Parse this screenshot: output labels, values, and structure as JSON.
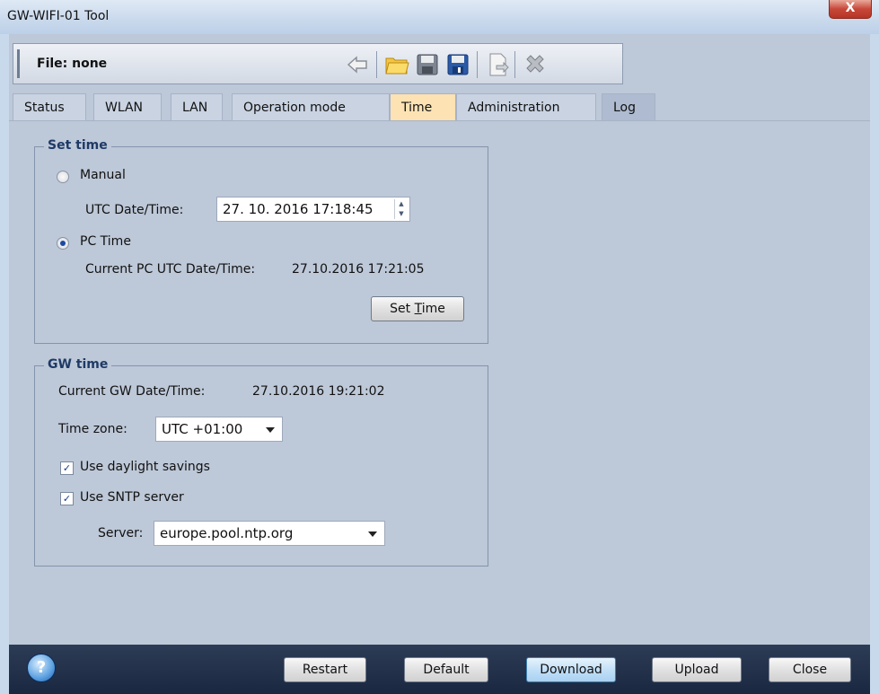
{
  "window": {
    "title": "GW-WIFI-01 Tool",
    "close_symbol": "X"
  },
  "toolbar": {
    "file_label": "File: none",
    "icons": [
      "back-arrow-icon",
      "open-folder-icon",
      "save-icon",
      "save-as-icon",
      "export-icon",
      "delete-icon"
    ]
  },
  "tabs": [
    "Status",
    "WLAN",
    "LAN",
    "Operation mode",
    "Time",
    "Administration",
    "Log"
  ],
  "active_tab": "Time",
  "set_time": {
    "legend": "Set time",
    "manual_label": "Manual",
    "utc_label": "UTC Date/Time:",
    "utc_value": "27. 10. 2016 17:18:45",
    "pc_time_label": "PC Time",
    "current_pc_label": "Current PC UTC Date/Time:",
    "current_pc_value": "27.10.2016 17:21:05",
    "set_time_prefix": "Set ",
    "set_time_underlined": "T",
    "set_time_suffix": "ime",
    "selected": "PC Time"
  },
  "gw_time": {
    "legend": "GW time",
    "current_gw_label": "Current GW Date/Time:",
    "current_gw_value": "27.10.2016 19:21:02",
    "timezone_label": "Time zone:",
    "timezone_value": "UTC +01:00",
    "daylight_label": "Use daylight savings",
    "daylight_checked": true,
    "sntp_label": "Use SNTP server",
    "sntp_checked": true,
    "server_label": "Server:",
    "server_value": "europe.pool.ntp.org"
  },
  "bottom": {
    "help_symbol": "?",
    "restart": "Restart",
    "default": "Default",
    "download": "Download",
    "upload": "Upload",
    "close": "Close"
  },
  "colors": {
    "panel_bg": "#bdc8d8",
    "active_tab": "#fde2b4",
    "bottom_bar": "#1a2740",
    "legend_text": "#1f3a66"
  }
}
